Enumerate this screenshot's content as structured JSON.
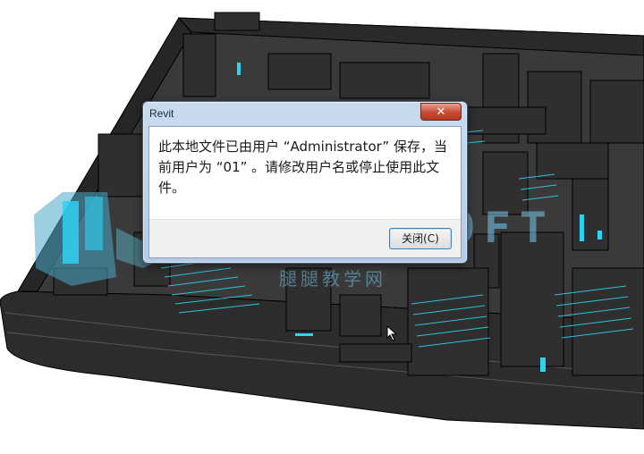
{
  "dialog": {
    "title": "Revit",
    "message": "此本地文件已由用户 “Administrator” 保存，当前用户为 “01” 。请修改用户名或停止使用此文件。",
    "close_glyph": "✕",
    "close_button_label": "关闭(C)"
  },
  "watermark": {
    "main": "TUITUISOFT",
    "sub": "腿腿教学网"
  },
  "colors": {
    "model_dark": "#2e2e2e",
    "model_edge": "#000000",
    "model_highlight": "#2ed2f2",
    "dialog_frame": "#b9cfe7",
    "close_red": "#c74a33"
  }
}
